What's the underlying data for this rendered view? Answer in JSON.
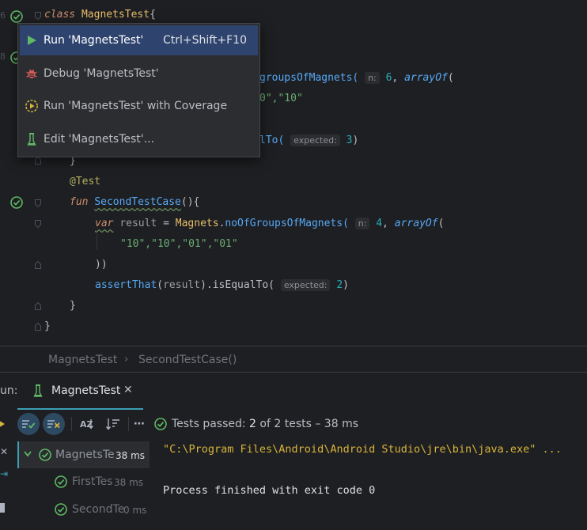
{
  "editor": {
    "line_numbers": [
      "6",
      "",
      "8",
      "",
      "",
      "",
      "",
      "",
      "",
      "",
      "",
      "",
      "",
      "",
      "",
      "",
      "",
      ""
    ],
    "lines": {
      "l1_class": "class",
      "l1_name": "MagnetsTest",
      "l1_brace": "{",
      "l4_frag1": "groupsOfMagnets(",
      "l4_hint": "n:",
      "l4_num": "6",
      "l4_comma": ",",
      "l4_arrayof": "arrayOf",
      "l4_paren": "(",
      "l5_frag": "0\",\"10\"",
      "l7_frag": "lTo(",
      "l7_hint": "expected:",
      "l7_num": "3",
      "l7_close": ")",
      "l8_brace": "}",
      "l9_ann": "@Test",
      "l10_fun": "fun",
      "l10_name": "SecondTestCase",
      "l10_rest": "(){",
      "l11_var": "var",
      "l11_result": "result",
      "l11_eq": " = ",
      "l11_obj": "Magnets",
      "l11_dot": ".",
      "l11_fn": "noOfGroupsOfMagnets(",
      "l11_hint": "n:",
      "l11_num": "4",
      "l11_comma": ",",
      "l11_arrayof": "arrayOf",
      "l11_paren": "(",
      "l12_strs": "\"10\",\"10\",\"01\",\"01\"",
      "l13_close": "))",
      "l14_assert": "assertThat",
      "l14_open": "(",
      "l14_result": "result",
      "l14_rest": ").isEqualTo(",
      "l14_hint": "expected:",
      "l14_num": "2",
      "l14_close": ")",
      "l15_brace": "}",
      "l16_brace": "}"
    }
  },
  "popup": {
    "items": [
      {
        "label": "Run 'MagnetsTest'",
        "shortcut": "Ctrl+Shift+F10",
        "icon": "run-icon"
      },
      {
        "label": "Debug 'MagnetsTest'",
        "shortcut": "",
        "icon": "debug-icon"
      },
      {
        "label": "Run 'MagnetsTest' with Coverage",
        "shortcut": "",
        "icon": "coverage-icon"
      },
      {
        "label": "Edit 'MagnetsTest'...",
        "shortcut": "",
        "icon": "edit-config-icon"
      }
    ]
  },
  "breadcrumb": {
    "items": [
      "MagnetsTest",
      "SecondTestCase()"
    ]
  },
  "run_panel": {
    "label": "un:",
    "tab_label": "MagnetsTest",
    "status": {
      "prefix": "Tests passed: ",
      "passed": "2",
      "suffix": " of 2 tests – 38 ms"
    },
    "tree": [
      {
        "label": "MagnetsTe",
        "time": "38 ms"
      },
      {
        "label": "FirstTes",
        "time": "38 ms"
      },
      {
        "label": "SecondTe",
        "time": "0 ms"
      }
    ],
    "console": {
      "line1": "\"C:\\Program Files\\Android\\Android Studio\\jre\\bin\\java.exe\" ...",
      "line2": "Process finished with exit code 0"
    }
  },
  "colors": {
    "accent": "#2e436e",
    "pass_green": "#5fb865",
    "tab_underline": "#3c9fb5"
  }
}
